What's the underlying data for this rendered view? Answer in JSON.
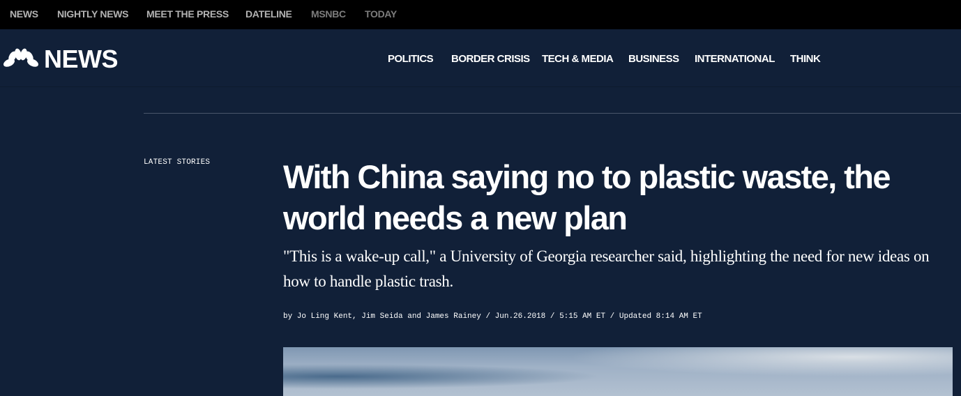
{
  "top_nav": {
    "items": [
      {
        "label": "NEWS"
      },
      {
        "label": "NIGHTLY NEWS"
      },
      {
        "label": "MEET THE PRESS"
      },
      {
        "label": "DATELINE"
      },
      {
        "label": "MSNBC"
      },
      {
        "label": "TODAY"
      }
    ]
  },
  "header": {
    "logo_text": "NEWS",
    "logo_icon": "peacock-icon",
    "nav": [
      {
        "label": "POLITICS"
      },
      {
        "label": "BORDER CRISIS"
      },
      {
        "label": "TECH & MEDIA"
      },
      {
        "label": "BUSINESS"
      },
      {
        "label": "INTERNATIONAL"
      },
      {
        "label": "THINK"
      }
    ]
  },
  "sidebar": {
    "label": "LATEST STORIES"
  },
  "article": {
    "headline": "With China saying no to plastic waste, the world needs a new plan",
    "dek": "\"This is a wake-up call,\" a University of Georgia researcher said, highlighting the need for new ideas on how to handle plastic trash.",
    "byline": "by Jo Ling Kent, Jim Seida and James Rainey / Jun.26.2018 / 5:15 AM ET / Updated 8:14 AM ET"
  },
  "colors": {
    "background": "#112038",
    "top_bar": "#000000",
    "top_link": "#b3b3b3",
    "top_link_dim": "#7d7d7d",
    "text": "#ffffff",
    "divider": "#4a566a"
  }
}
